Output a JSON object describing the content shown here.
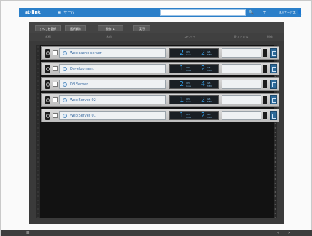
{
  "header": {
    "brand": "at-link",
    "nav_arrow": "◉",
    "nav_title": "サーバ",
    "search_value": "",
    "search_icon": "🔍",
    "add_icon": "+",
    "account_label": "法人サービス",
    "user_icon": "👤▾"
  },
  "toolbar": {
    "select_all": "すべてを選択",
    "deselect": "選択解除",
    "action_select": "操作 ↕",
    "execute": "実行"
  },
  "columns": {
    "status": "状態",
    "name": "名前",
    "spec": "スペック",
    "ip": "IPアドレス",
    "console": "操作"
  },
  "servers": [
    {
      "name": "Web cache server",
      "cpu": "2",
      "cpu_label": "CPU\nCore",
      "mem": "2",
      "mem_label": "GB\nMEM"
    },
    {
      "name": "Development",
      "cpu": "1",
      "cpu_label": "CPU\nCore",
      "mem": "2",
      "mem_label": "GB\nMEM"
    },
    {
      "name": "DB Server",
      "cpu": "2",
      "cpu_label": "CPU\nCore",
      "mem": "4",
      "mem_label": "GB\nMEM"
    },
    {
      "name": "Web Server 02",
      "cpu": "1",
      "cpu_label": "CPU\nCore",
      "mem": "2",
      "mem_label": "GB\nMEM"
    },
    {
      "name": "Web Server 01",
      "cpu": "1",
      "cpu_label": "CPU\nCore",
      "mem": "2",
      "mem_label": "GB\nMEM"
    }
  ],
  "statusbar": {
    "menu_icon": "☰",
    "prev_icon": "‹",
    "next_icon": "›"
  },
  "colors": {
    "header_blue": "#2b7fc9",
    "panel_dark": "#3a3a3a",
    "spec_digits": "#34a0e8",
    "name_text": "#3b6da3"
  }
}
